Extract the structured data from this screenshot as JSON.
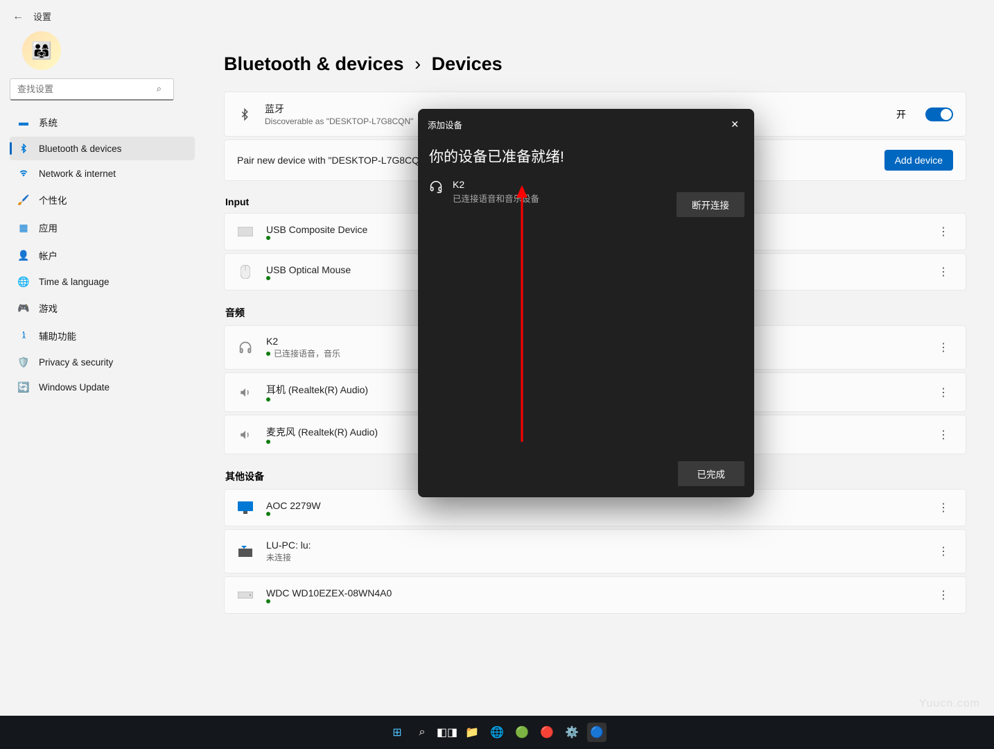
{
  "header": {
    "title": "设置"
  },
  "search": {
    "placeholder": "查找设置"
  },
  "sidebar": {
    "items": [
      {
        "label": "系统",
        "icon": "🖥️"
      },
      {
        "label": "Bluetooth & devices",
        "icon": "bt"
      },
      {
        "label": "Network & internet",
        "icon": "📶"
      },
      {
        "label": "个性化",
        "icon": "🖌️"
      },
      {
        "label": "应用",
        "icon": "▦"
      },
      {
        "label": "帐户",
        "icon": "👤"
      },
      {
        "label": "Time & language",
        "icon": "🌐"
      },
      {
        "label": "游戏",
        "icon": "🎮"
      },
      {
        "label": "辅助功能",
        "icon": "♿"
      },
      {
        "label": "Privacy & security",
        "icon": "🛡️"
      },
      {
        "label": "Windows Update",
        "icon": "🔄"
      }
    ]
  },
  "breadcrumb": {
    "parent": "Bluetooth & devices",
    "current": "Devices"
  },
  "bluetooth": {
    "title": "蓝牙",
    "sub": "Discoverable as \"DESKTOP-L7G8CQN\"",
    "toggle_label": "开"
  },
  "pair": {
    "text": "Pair new device with \"DESKTOP-L7G8CQN\"",
    "button": "Add device"
  },
  "sections": {
    "input": {
      "title": "Input",
      "devices": [
        {
          "name": "USB Composite Device",
          "status": ""
        },
        {
          "name": "USB Optical Mouse",
          "status": ""
        }
      ]
    },
    "audio": {
      "title": "音频",
      "devices": [
        {
          "name": "K2",
          "status": "已连接语音，音乐"
        },
        {
          "name": "耳机 (Realtek(R) Audio)",
          "status": ""
        },
        {
          "name": "麦克风 (Realtek(R) Audio)",
          "status": ""
        }
      ]
    },
    "other": {
      "title": "其他设备",
      "devices": [
        {
          "name": "AOC 2279W",
          "status": ""
        },
        {
          "name": "LU-PC: lu:",
          "status": "未连接",
          "nodot": true
        },
        {
          "name": "WDC WD10EZEX-08WN4A0",
          "status": ""
        }
      ]
    }
  },
  "dialog": {
    "header": "添加设备",
    "title": "你的设备已准备就绪!",
    "device_name": "K2",
    "device_sub": "已连接语音和音乐设备",
    "disconnect": "断开连接",
    "done": "已完成"
  },
  "watermark": "Yuucn.com",
  "colors": {
    "accent": "#0067c0",
    "dialog_bg": "#202020",
    "arrow": "#ff0000"
  }
}
